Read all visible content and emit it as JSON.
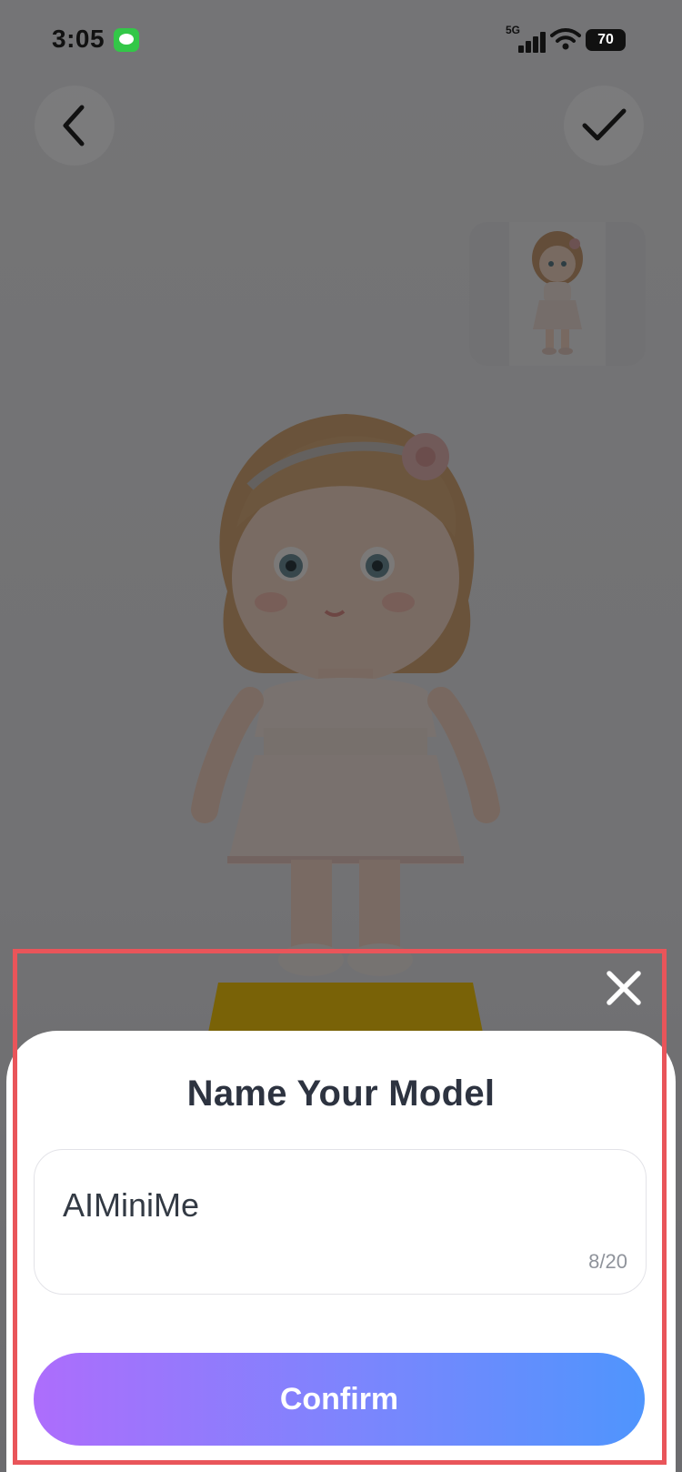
{
  "status_bar": {
    "time": "3:05",
    "network_label": "5G",
    "battery_level": "70"
  },
  "nav": {
    "back_icon": "chevron-left-icon",
    "confirm_icon": "checkmark-icon"
  },
  "preview": {
    "thumbnail": "doll-thumbnail",
    "main_image": "doll-model-image"
  },
  "dialog": {
    "title": "Name Your Model",
    "name_value": "AIMiniMe",
    "char_count": "8/20",
    "confirm_label": "Confirm",
    "close_icon": "close-icon"
  },
  "colors": {
    "title_text": "#2d3340",
    "confirm_gradient_start": "#ad6dfc",
    "confirm_gradient_end": "#4f95fd",
    "highlight_border": "#e9555a",
    "message_app_green": "#33c748"
  }
}
